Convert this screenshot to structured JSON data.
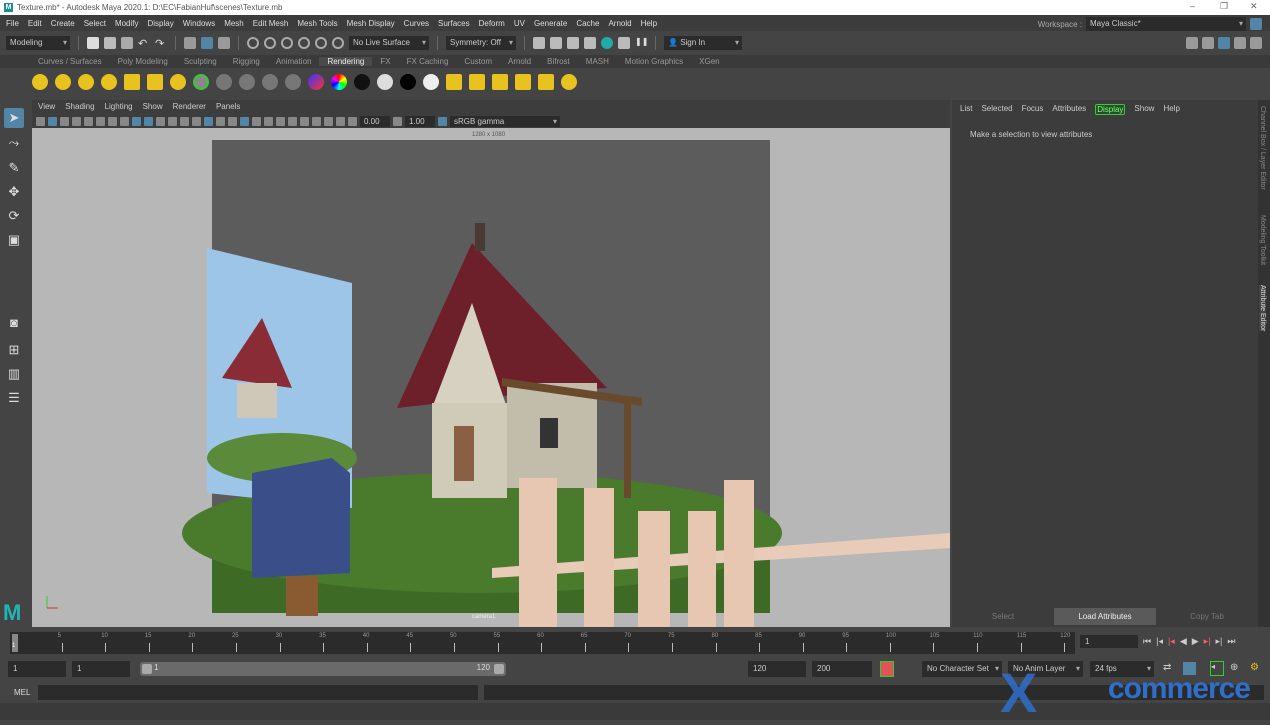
{
  "window": {
    "title": "Texture.mb* - Autodesk Maya 2020.1: D:\\EC\\FabianHuf\\scenes\\Texture.mb",
    "minimize": "–",
    "maximize": "❐",
    "close": "✕"
  },
  "menubar": [
    "File",
    "Edit",
    "Create",
    "Select",
    "Modify",
    "Display",
    "Windows",
    "Mesh",
    "Edit Mesh",
    "Mesh Tools",
    "Mesh Display",
    "Curves",
    "Surfaces",
    "Deform",
    "UV",
    "Generate",
    "Cache",
    "Arnold",
    "Help"
  ],
  "workspace": {
    "label": "Workspace :",
    "value": "Maya Classic*"
  },
  "statusline": {
    "mode": "Modeling",
    "live_surface": "No Live Surface",
    "symmetry": "Symmetry: Off",
    "sign_in": "Sign In"
  },
  "shelf_tabs": [
    "Curves / Surfaces",
    "Poly Modeling",
    "Sculpting",
    "Rigging",
    "Animation",
    "Rendering",
    "FX",
    "FX Caching",
    "Custom",
    "Arnold",
    "Bifrost",
    "MASH",
    "Motion Graphics",
    "XGen"
  ],
  "shelf_active": "Rendering",
  "panel_menu": [
    "View",
    "Shading",
    "Lighting",
    "Show",
    "Renderer",
    "Panels"
  ],
  "panel_toolbar": {
    "exposure": "0.00",
    "gamma": "1.00",
    "color_space": "sRGB gamma"
  },
  "viewport": {
    "resolution": "1280 x 1080",
    "camera": "camera1"
  },
  "attribute_editor": {
    "menu": [
      "List",
      "Selected",
      "Focus",
      "Attributes",
      "Display",
      "Show",
      "Help"
    ],
    "highlighted": "Display",
    "message": "Make a selection to view attributes",
    "buttons": [
      "Select",
      "Load Attributes",
      "Copy Tab"
    ]
  },
  "side_tabs": [
    "Channel Box / Layer Editor",
    "Modeling Toolkit",
    "Attribute Editor"
  ],
  "timeline": {
    "ticks": [
      "5",
      "10",
      "15",
      "20",
      "25",
      "30",
      "35",
      "40",
      "45",
      "50",
      "55",
      "60",
      "65",
      "70",
      "75",
      "80",
      "85",
      "90",
      "95",
      "100",
      "105",
      "110",
      "115",
      "120"
    ],
    "current_frame": "1",
    "frame_field": "1"
  },
  "range": {
    "start": "1",
    "playback_start": "1",
    "slider_start": "1",
    "slider_end": "120",
    "playback_end": "120",
    "end": "200",
    "character_set": "No Character Set",
    "anim_layer": "No Anim Layer",
    "fps": "24 fps"
  },
  "command_line": {
    "label": "MEL"
  },
  "watermark": {
    "x": "X",
    "text": "commerce"
  },
  "colors": {
    "accent_green": "#33cc33",
    "bg": "#444444",
    "field": "#2b2b2b",
    "selected_blue": "#5285a6"
  }
}
